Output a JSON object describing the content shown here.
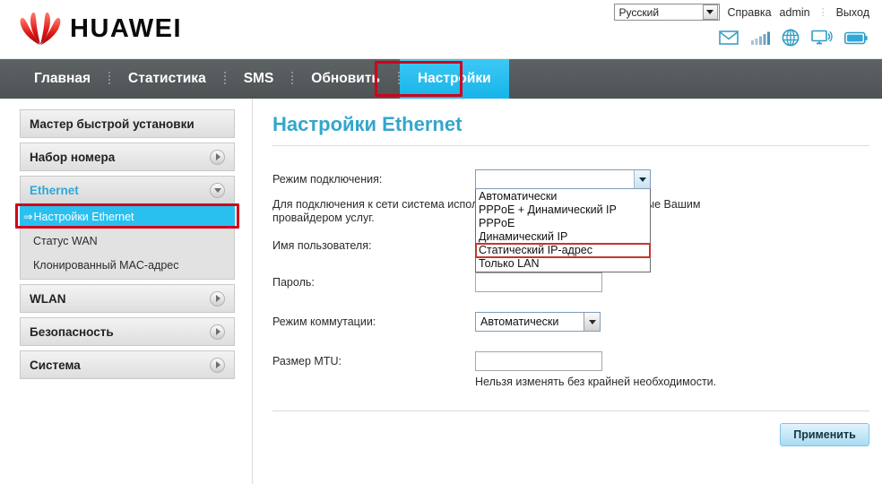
{
  "brand": {
    "name": "HUAWEI",
    "logo_color": "#d81a1a",
    "logo_icon": "huawei-flower-logo"
  },
  "header": {
    "language": {
      "selected": "Русский",
      "options": [
        "Русский"
      ]
    },
    "links": [
      {
        "label": "Справка",
        "name": "help-link"
      },
      {
        "label": "admin",
        "name": "user-link"
      },
      {
        "label": "Выход",
        "name": "logout-link"
      }
    ],
    "status_icons": [
      {
        "name": "envelope-icon",
        "title": "SMS"
      },
      {
        "name": "signal-bars-icon",
        "title": "Signal"
      },
      {
        "name": "globe-icon",
        "title": "Network"
      },
      {
        "name": "monitor-wifi-icon",
        "title": "WLAN"
      },
      {
        "name": "battery-icon",
        "title": "Battery"
      }
    ]
  },
  "nav": {
    "items": [
      {
        "label": "Главная",
        "active": false
      },
      {
        "label": "Статистика",
        "active": false
      },
      {
        "label": "SMS",
        "active": false
      },
      {
        "label": "Обновить",
        "active": false
      },
      {
        "label": "Настройки",
        "active": true
      }
    ],
    "active_color": "#29c0f0",
    "bar_color": "#555a5c",
    "annotation_color": "#d0021b"
  },
  "sidebar": {
    "groups": [
      {
        "label": "Мастер быстрой установки",
        "has_chevron": false,
        "expanded": false,
        "items": []
      },
      {
        "label": "Набор номера",
        "has_chevron": true,
        "expanded": false,
        "items": []
      },
      {
        "label": "Ethernet",
        "has_chevron": true,
        "expanded": true,
        "items": [
          {
            "label": "Настройки Ethernet",
            "selected": true,
            "arrow": "⇒"
          },
          {
            "label": "Статус WAN",
            "selected": false
          },
          {
            "label": "Клонированный MAC-адрес",
            "selected": false
          }
        ]
      },
      {
        "label": "WLAN",
        "has_chevron": true,
        "expanded": false,
        "items": []
      },
      {
        "label": "Безопасность",
        "has_chevron": true,
        "expanded": false,
        "items": []
      },
      {
        "label": "Система",
        "has_chevron": true,
        "expanded": false,
        "items": []
      }
    ]
  },
  "main": {
    "title": "Настройки Ethernet",
    "title_color": "#33a6cc",
    "connection_mode": {
      "label": "Режим подключения:",
      "selected": "",
      "dropdown_open": true,
      "options": [
        {
          "label": "Автоматически",
          "marked": false
        },
        {
          "label": "PPPoE + Динамический IP",
          "marked": false
        },
        {
          "label": "PPPoE",
          "marked": false
        },
        {
          "label": "Динамический IP",
          "marked": false
        },
        {
          "label": "Статический IP-адрес",
          "marked": true
        },
        {
          "label": "Только LAN",
          "marked": false
        }
      ]
    },
    "description": "Для подключения к сети система использует настройки, предоставленные Вашим провайдером услуг.",
    "username": {
      "label": "Имя пользователя:",
      "value": ""
    },
    "password": {
      "label": "Пароль:",
      "value": ""
    },
    "switch_mode": {
      "label": "Режим коммутации:",
      "selected": "Автоматически"
    },
    "mtu": {
      "label": "Размер MTU:",
      "value": "",
      "hint": "Нельзя изменять без крайней необходимости."
    },
    "apply_button": "Применить"
  }
}
